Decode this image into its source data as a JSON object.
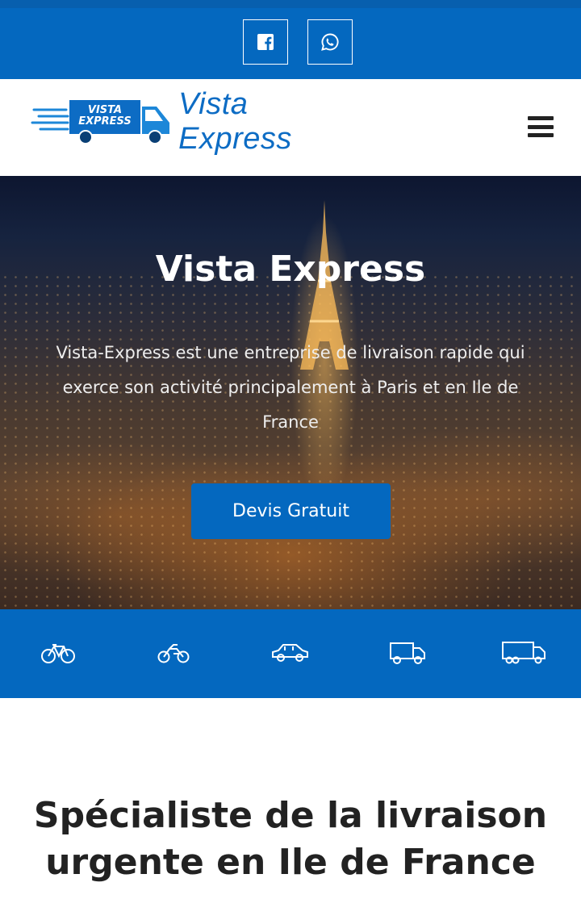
{
  "social": {
    "facebook_icon": "facebook-icon",
    "whatsapp_icon": "whatsapp-icon"
  },
  "header": {
    "logo_badge_line1": "VISTA",
    "logo_badge_line2": "EXPRESS",
    "logo_text": "Vista Express",
    "menu_icon": "hamburger-icon"
  },
  "hero": {
    "title": "Vista Express",
    "description": "Vista-Express est une entreprise de livraison rapide qui exerce son activité principalement à Paris et en Ile de France",
    "cta_label": "Devis Gratuit"
  },
  "vehicles": [
    {
      "icon": "bicycle-icon"
    },
    {
      "icon": "motorcycle-icon"
    },
    {
      "icon": "car-icon"
    },
    {
      "icon": "van-icon"
    },
    {
      "icon": "truck-icon"
    }
  ],
  "section": {
    "title": "Spécialiste de la livraison urgente en Ile de France"
  },
  "colors": {
    "primary": "#0468bf",
    "logo_blue": "#0d6cc4",
    "text_dark": "#222222"
  }
}
